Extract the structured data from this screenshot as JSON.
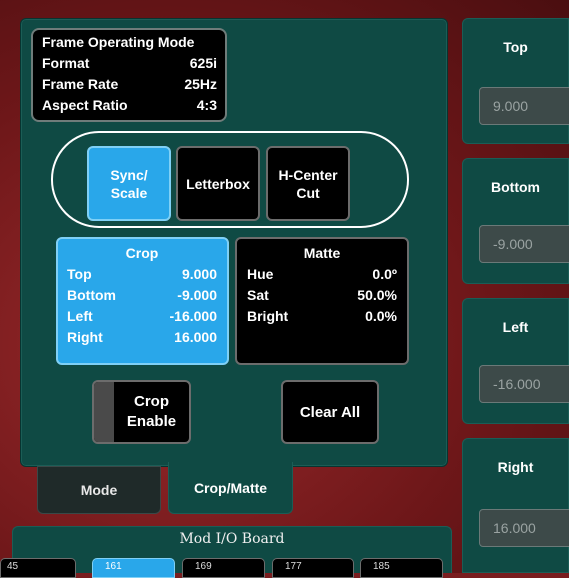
{
  "frame_operating_mode": {
    "title": "Frame Operating Mode",
    "rows": [
      {
        "label": "Format",
        "value": "625i"
      },
      {
        "label": "Frame Rate",
        "value": "25Hz"
      },
      {
        "label": "Aspect Ratio",
        "value": "4:3"
      }
    ]
  },
  "mode_buttons": [
    {
      "label": "Sync/\nScale",
      "active": true
    },
    {
      "label": "Letterbox",
      "active": false
    },
    {
      "label": "H-Center\nCut",
      "active": false
    }
  ],
  "crop": {
    "title": "Crop",
    "rows": [
      {
        "label": "Top",
        "value": "9.000"
      },
      {
        "label": "Bottom",
        "value": "-9.000"
      },
      {
        "label": "Left",
        "value": "-16.000"
      },
      {
        "label": "Right",
        "value": "16.000"
      }
    ]
  },
  "matte": {
    "title": "Matte",
    "rows": [
      {
        "label": "Hue",
        "value": "0.0º"
      },
      {
        "label": "Sat",
        "value": "50.0%"
      },
      {
        "label": "Bright",
        "value": "0.0%"
      }
    ]
  },
  "crop_enable_label": "Crop\nEnable",
  "clear_all_label": "Clear All",
  "tabs": [
    {
      "label": "Mode",
      "active": false
    },
    {
      "label": "Crop/Matte",
      "active": true
    }
  ],
  "mod_io": {
    "title": "Mod I/O Board",
    "slots": [
      "45",
      "161",
      "169",
      "177",
      "185"
    ],
    "active_slot": "161"
  },
  "side_panels": [
    {
      "label": "Top",
      "value": "9.000"
    },
    {
      "label": "Bottom",
      "value": "-9.000"
    },
    {
      "label": "Left",
      "value": "-16.000"
    },
    {
      "label": "Right",
      "value": "16.000"
    }
  ],
  "colors": {
    "panel": "#0f4a44",
    "active": "#29a7ea",
    "background": "#7a1d1f"
  }
}
